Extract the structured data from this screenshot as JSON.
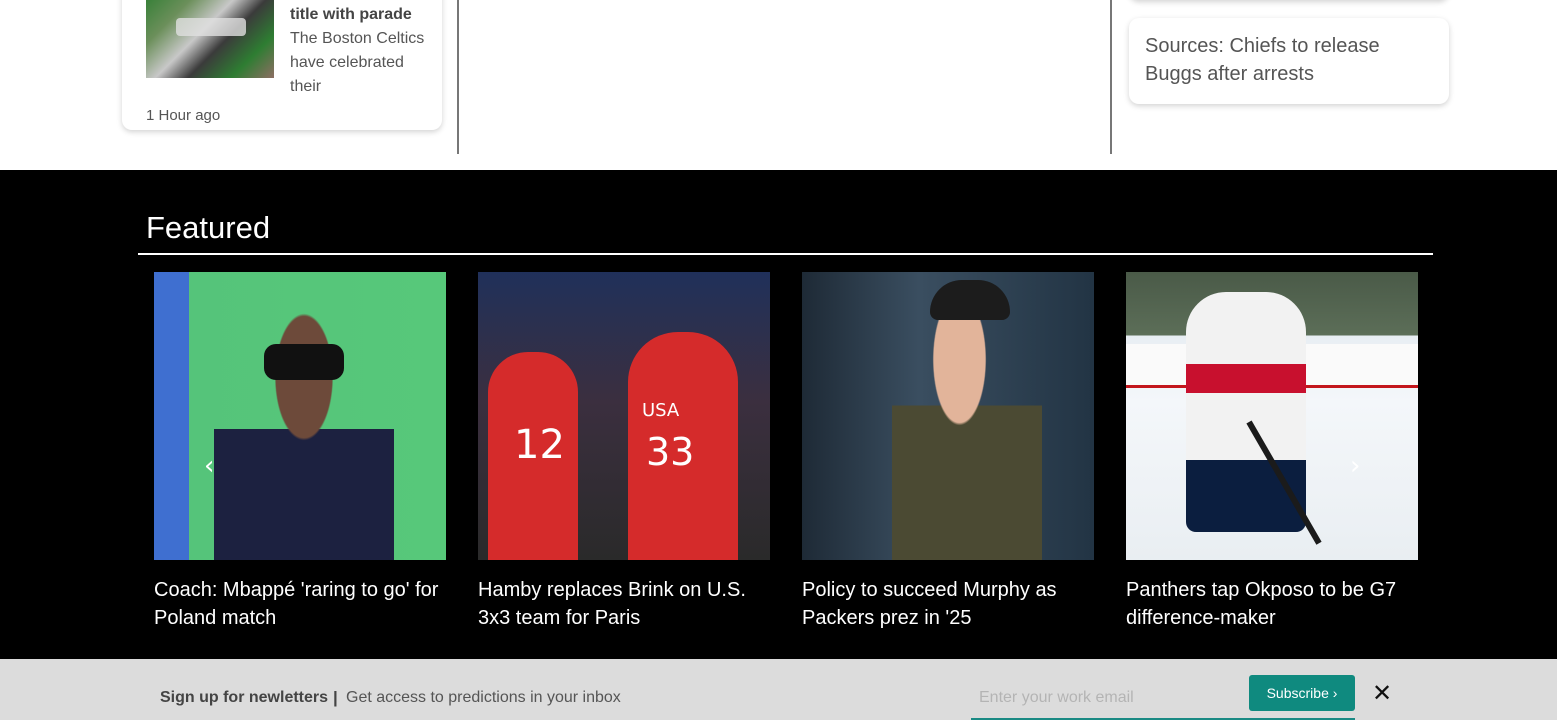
{
  "top": {
    "left_card": {
      "headline": "title with parade",
      "body": "The Boston Celtics have celebrated their",
      "time": "1 Hour ago"
    },
    "right_card": {
      "headline": "Sources: Chiefs to release Buggs after arrests"
    }
  },
  "featured": {
    "title": "Featured",
    "items": [
      {
        "caption": "Coach: Mbappé 'raring to go' for Poland match",
        "jersey": ""
      },
      {
        "caption": "Hamby replaces Brink on U.S. 3x3 team for Paris",
        "jersey_a": "12",
        "jersey_b": "33",
        "chest": "USA"
      },
      {
        "caption": "Policy to succeed Murphy as Packers prez in '25"
      },
      {
        "caption": "Panthers tap Okposo to be G7 difference-maker"
      }
    ],
    "prev_icon": "chevron-left-icon",
    "next_icon": "chevron-right-icon"
  },
  "newsletter": {
    "label": "Sign up for newletters",
    "separator": "|",
    "subtitle": "Get access to predictions in your inbox",
    "email_placeholder": "Enter your work email",
    "subscribe_label": "Subscribe ›",
    "close_icon": "close-icon"
  },
  "colors": {
    "accent": "#0f8a7f",
    "featured_bg": "#000000",
    "newsletter_bg": "#dcdcdc"
  }
}
